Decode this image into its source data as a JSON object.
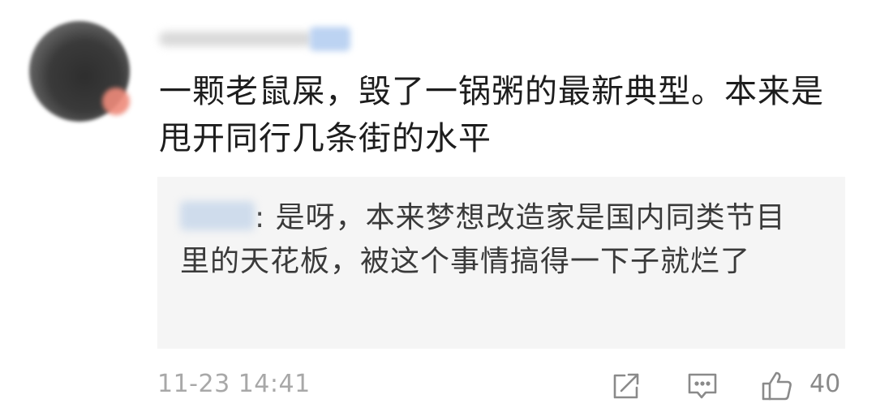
{
  "comment": {
    "author": "",
    "text": "一颗老鼠屎，毁了一锅粥的最新典型。本来是甩开同行几条街的水平",
    "reply": {
      "author": "",
      "separator": ":",
      "text": "是呀，本来梦想改造家是国内同类节目里的天花板，被这个事情搞得一下子就烂了"
    },
    "timestamp": "11-23 14:41",
    "like_count": "40"
  },
  "icons": {
    "share": "share-icon",
    "reply": "comment-icon",
    "like": "thumbs-up-icon"
  },
  "colors": {
    "text": "#1d1d1d",
    "reply_background": "#f5f5f5",
    "meta": "#a8a8a8"
  }
}
